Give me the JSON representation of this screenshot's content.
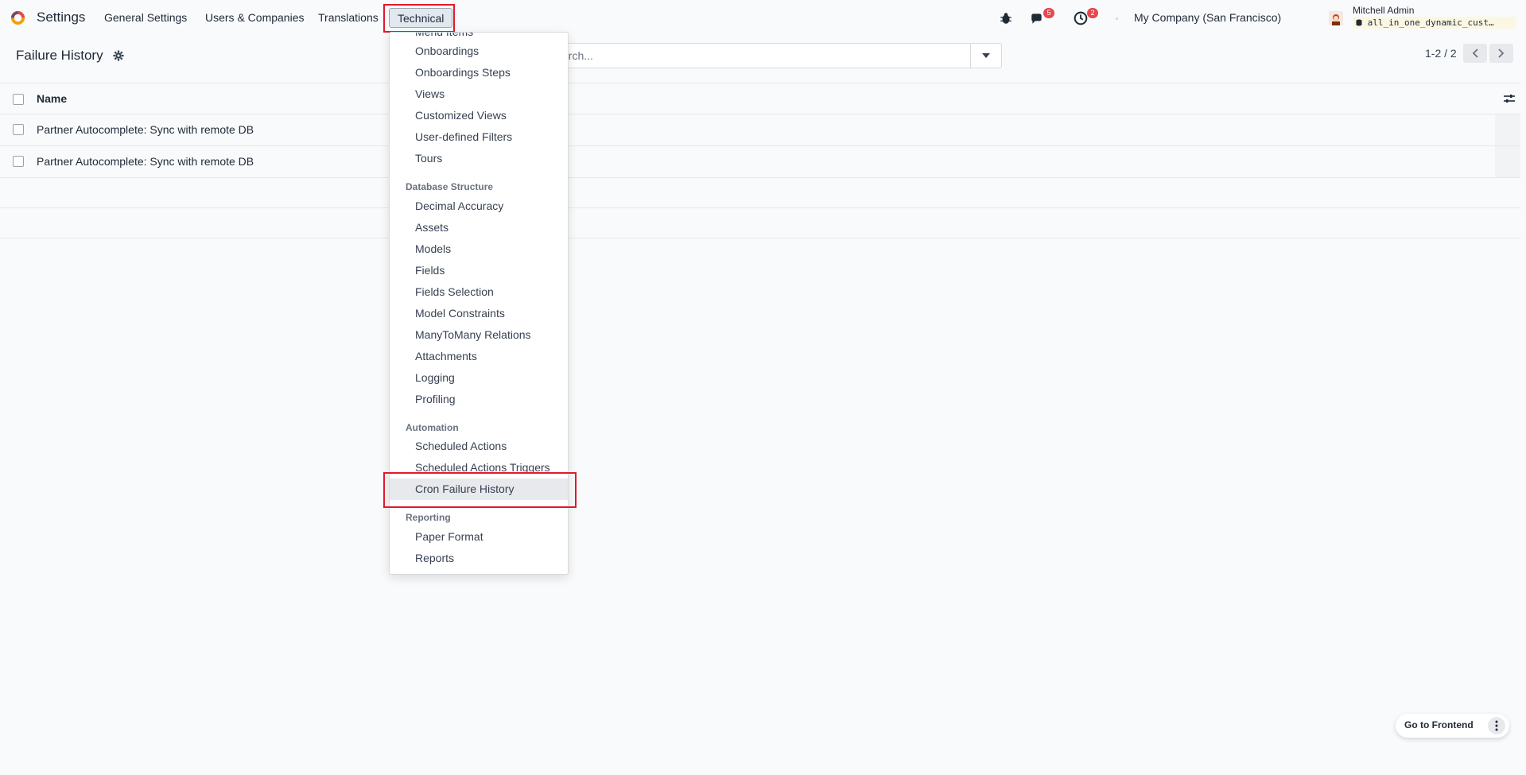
{
  "navbar": {
    "app_title": "Settings",
    "menu": [
      "General Settings",
      "Users & Companies",
      "Translations",
      "Technical"
    ],
    "messages_count": "5",
    "activities_count": "2",
    "company": "My Company (San Francisco)",
    "user_name": "Mitchell Admin",
    "database": "all_in_one_dynamic_cust…"
  },
  "control_panel": {
    "title": "Failure History",
    "search_placeholder": "Search...",
    "search_visible": "arch...",
    "pager": "1-2 / 2"
  },
  "list": {
    "column_name": "Name",
    "rows": [
      "Partner Autocomplete: Sync with remote DB",
      "Partner Autocomplete: Sync with remote DB"
    ]
  },
  "dropdown": {
    "cut_item": "Menu Items",
    "group1": [
      "Onboardings",
      "Onboardings Steps",
      "Views",
      "Customized Views",
      "User-defined Filters",
      "Tours"
    ],
    "section_db": "Database Structure",
    "group2": [
      "Decimal Accuracy",
      "Assets",
      "Models",
      "Fields",
      "Fields Selection",
      "Model Constraints",
      "ManyToMany Relations",
      "Attachments",
      "Logging",
      "Profiling"
    ],
    "section_automation": "Automation",
    "group3": [
      "Scheduled Actions",
      "Scheduled Actions Triggers",
      "Cron Failure History"
    ],
    "section_reporting": "Reporting",
    "group4": [
      "Paper Format",
      "Reports"
    ]
  },
  "footer": {
    "frontend_button": "Go to Frontend"
  },
  "colors": {
    "highlight_box": "#e3182d",
    "badge": "#e5484d",
    "brand": "#714b67"
  },
  "icons": [
    "odoo-logo-icon",
    "bug-icon",
    "chat-icon",
    "clock-icon",
    "gear-icon",
    "caret-down-icon",
    "chevron-left-icon",
    "chevron-right-icon",
    "sliders-icon",
    "kebab-icon",
    "database-icon"
  ]
}
